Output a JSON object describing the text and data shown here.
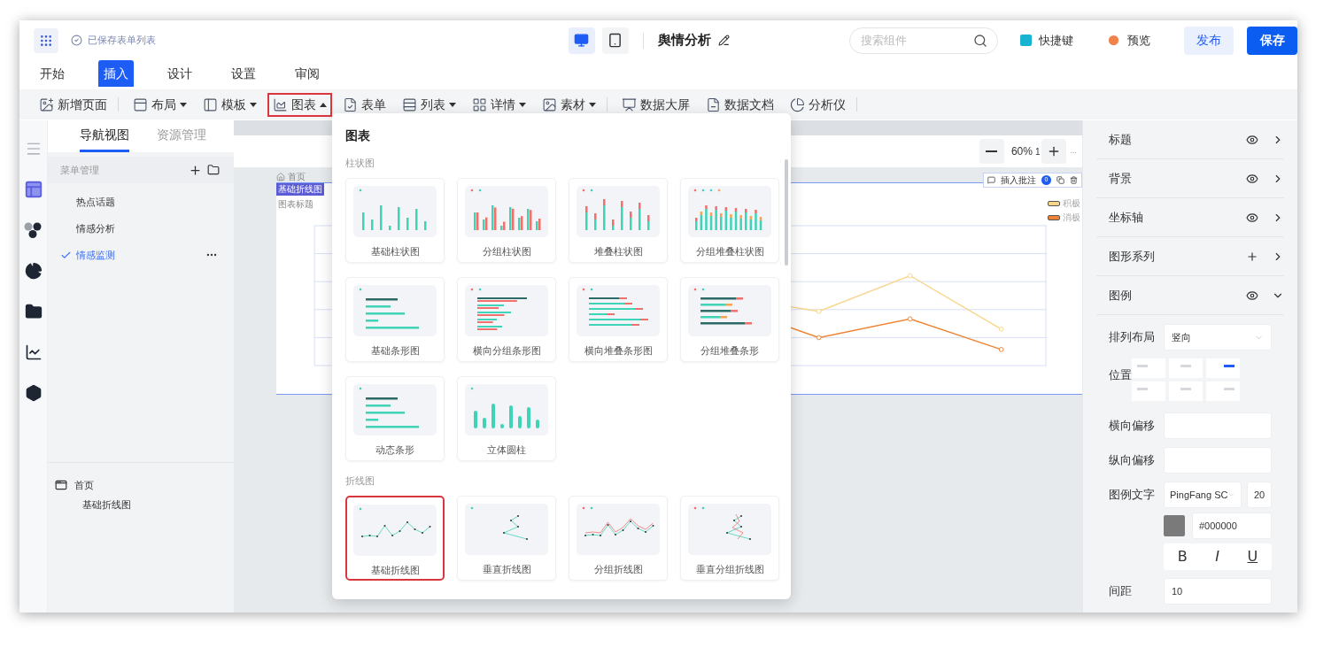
{
  "header": {
    "save_status": "已保存表单列表",
    "devices": [
      {
        "selected": true
      },
      {
        "selected": false
      }
    ],
    "title": "舆情分析",
    "search": {
      "placeholder": "搜索组件"
    },
    "shortcut": "快捷键",
    "preview": "预览",
    "publish": "发布",
    "save": "保存"
  },
  "tabs": [
    {
      "label": "开始",
      "selected": false
    },
    {
      "label": "插入",
      "selected": true
    },
    {
      "label": "设计",
      "selected": false
    },
    {
      "label": "设置",
      "selected": false
    },
    {
      "label": "审阅",
      "selected": false
    }
  ],
  "toolbar": [
    {
      "label": "新增页面",
      "has_menu": false,
      "selected": false,
      "divider_after": true
    },
    {
      "label": "布局",
      "has_menu": true,
      "selected": false,
      "divider_after": false
    },
    {
      "label": "模板",
      "has_menu": true,
      "selected": false,
      "divider_after": false
    },
    {
      "label": "图表",
      "has_menu": true,
      "selected": true,
      "divider_after": false
    },
    {
      "label": "表单",
      "has_menu": false,
      "selected": false,
      "divider_after": false
    },
    {
      "label": "列表",
      "has_menu": true,
      "selected": false,
      "divider_after": false
    },
    {
      "label": "详情",
      "has_menu": true,
      "selected": false,
      "divider_after": false
    },
    {
      "label": "素材",
      "has_menu": true,
      "selected": false,
      "divider_after": true
    },
    {
      "label": "数据大屏",
      "has_menu": false,
      "selected": false,
      "divider_after": false
    },
    {
      "label": "数据文档",
      "has_menu": false,
      "selected": false,
      "divider_after": false
    },
    {
      "label": "分析仪",
      "has_menu": false,
      "selected": false,
      "divider_after": true
    }
  ],
  "rail": [
    {
      "selected": false
    },
    {
      "selected": true
    },
    {
      "selected": false
    },
    {
      "selected": false
    },
    {
      "selected": false
    },
    {
      "selected": false
    },
    {
      "selected": false
    }
  ],
  "nav": {
    "tabs": [
      {
        "label": "导航视图",
        "selected": true
      },
      {
        "label": "资源管理",
        "selected": false
      }
    ],
    "menu_header": "菜单管理",
    "items": [
      {
        "label": "热点话题",
        "selected": false
      },
      {
        "label": "情感分析",
        "selected": false
      },
      {
        "label": "情感监测",
        "selected": true
      }
    ],
    "pages": [
      {
        "label": "首页",
        "children": [
          {
            "label": "基础折线图"
          }
        ]
      }
    ]
  },
  "canvas": {
    "zoom": "60%",
    "zoom_extra": "1",
    "more": "...",
    "breadcrumb": "首页",
    "tag": "基础折线图",
    "chart_title": "图表标题",
    "annotate": "插入批注",
    "annotate_count": "0",
    "legend": [
      {
        "label": "积极",
        "color": "#f7d68c"
      },
      {
        "label": "消极",
        "color": "#ee8434"
      }
    ]
  },
  "chart_menu": {
    "title": "图表",
    "sections": [
      {
        "title": "柱状图",
        "items": [
          {
            "label": "基础柱状图",
            "kind": "bar",
            "selected": false
          },
          {
            "label": "分组柱状图",
            "kind": "groupbar",
            "selected": false
          },
          {
            "label": "堆叠柱状图",
            "kind": "stackbar",
            "selected": false
          },
          {
            "label": "分组堆叠柱状图",
            "kind": "groupstackbar",
            "selected": false
          },
          {
            "label": "基础条形图",
            "kind": "hbar",
            "selected": false
          },
          {
            "label": "横向分组条形图",
            "kind": "grouphbar",
            "selected": false
          },
          {
            "label": "横向堆叠条形图",
            "kind": "stackhbar",
            "selected": false
          },
          {
            "label": "分组堆叠条形",
            "kind": "groupstackhbar",
            "selected": false
          },
          {
            "label": "动态条形",
            "kind": "dynamichbar",
            "selected": false
          },
          {
            "label": "立体圆柱",
            "kind": "cylinder",
            "selected": false
          }
        ]
      },
      {
        "title": "折线图",
        "items": [
          {
            "label": "基础折线图",
            "kind": "line",
            "selected": true
          },
          {
            "label": "垂直折线图",
            "kind": "vline",
            "selected": false
          },
          {
            "label": "分组折线图",
            "kind": "groupline",
            "selected": false
          },
          {
            "label": "垂直分组折线图",
            "kind": "groupvline",
            "selected": false
          }
        ]
      }
    ]
  },
  "properties": {
    "sections": [
      {
        "label": "标题",
        "kind": "toggle",
        "expanded": false
      },
      {
        "label": "背景",
        "kind": "toggle",
        "expanded": false
      },
      {
        "label": "坐标轴",
        "kind": "toggle",
        "expanded": false
      },
      {
        "label": "图形系列",
        "kind": "add",
        "expanded": false
      },
      {
        "label": "图例",
        "kind": "toggle",
        "expanded": true
      }
    ],
    "legend_form": {
      "layout": {
        "label": "排列布局",
        "value": "竖向"
      },
      "position": {
        "label": "位置",
        "options": [
          {
            "selected": false
          },
          {
            "selected": false
          },
          {
            "selected": true
          },
          {
            "selected": false
          },
          {
            "selected": false
          },
          {
            "selected": false
          }
        ]
      },
      "offset_x": {
        "label": "横向偏移"
      },
      "offset_y": {
        "label": "纵向偏移"
      },
      "text": {
        "label": "图例文字",
        "font": "PingFang SC",
        "size": "20",
        "color_value": "#000000",
        "styles": [
          "B",
          "I",
          "U"
        ]
      },
      "spacing": {
        "label": "间距",
        "value": "10"
      }
    }
  }
}
